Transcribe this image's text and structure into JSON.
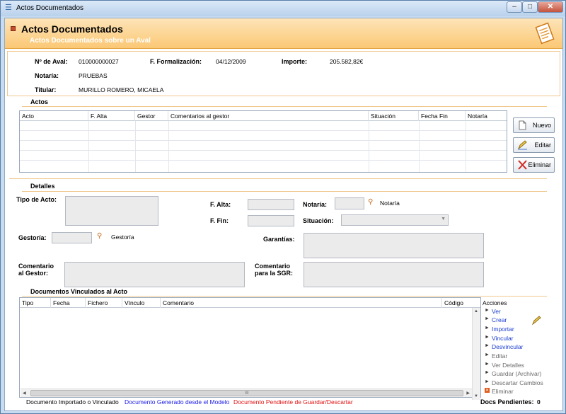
{
  "window": {
    "title": "Actos Documentados"
  },
  "banner": {
    "title": "Actos Documentados",
    "subtitle": "Actos Documentados sobre un Aval"
  },
  "summary": {
    "aval_label": "Nº de Aval:",
    "aval_value": "010000000027",
    "formalizacion_label": "F. Formalización:",
    "formalizacion_value": "04/12/2009",
    "importe_label": "Importe:",
    "importe_value": "205.582,82€",
    "notaria_label": "Notaría:",
    "notaria_value": "PRUEBAS",
    "titular_label": "Titular:",
    "titular_value": "MURILLO ROMERO, MICAELA"
  },
  "actos": {
    "title": "Actos",
    "columns": [
      "Acto",
      "F. Alta",
      "Gestor",
      "Comentarios al gestor",
      "Situación",
      "Fecha Fin",
      "Notaría"
    ],
    "buttons": {
      "nuevo": "Nuevo",
      "editar": "Editar",
      "eliminar": "Eliminar"
    }
  },
  "detalles": {
    "title": "Detalles",
    "tipo_label": "Tipo de Acto:",
    "falta_label": "F. Alta:",
    "notaria_label": "Notaría:",
    "notaria_link": "Notaría",
    "ffin_label": "F. Fin:",
    "situacion_label": "Situación:",
    "gestoria_label": "Gestoría:",
    "gestoria_link": "Gestoría",
    "garantias_label": "Garantías:",
    "comentario_gestor_label1": "Comentario",
    "comentario_gestor_label2": "al Gestor:",
    "comentario_sgr_label1": "Comentario",
    "comentario_sgr_label2": "para la SGR:"
  },
  "documentos": {
    "title": "Documentos Vinculados al Acto",
    "columns": [
      "Tipo",
      "Fecha",
      "Fichero",
      "Vínculo",
      "Comentario",
      "Código"
    ],
    "scroll_grip": "III"
  },
  "acciones": {
    "title": "Acciones",
    "items": [
      "Ver",
      "Crear",
      "Importar",
      "Vincular",
      "Desvincular",
      "Editar",
      "Ver Detalles",
      "Guardar (Archivar)",
      "Descartar Cambios",
      "Eliminar"
    ]
  },
  "legend": {
    "importado": "Documento Importado o Vinculado",
    "generado": "Documento Generado desde el Modelo",
    "pendiente": "Documento Pendiente de Guardar/Descartar",
    "pendientes_label": "Docs Pendientes:",
    "pendientes_value": "0"
  },
  "colors": {
    "generado": "#1a1ae6",
    "pendiente": "#e01010",
    "accent": "#fbc875"
  }
}
